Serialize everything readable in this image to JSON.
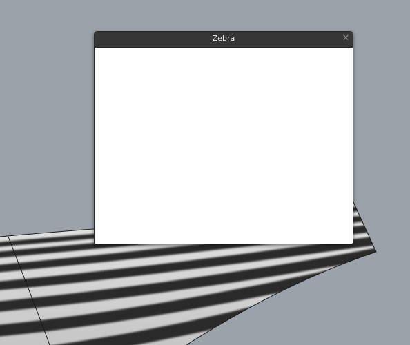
{
  "window": {
    "title": "Zebra",
    "close_glyph": "✕",
    "close_icon": "close-icon"
  },
  "viewport": {
    "background": "#9ca2aa",
    "surface_light": "#d2d2d2",
    "stripe_dark": "#2b2b2b"
  }
}
